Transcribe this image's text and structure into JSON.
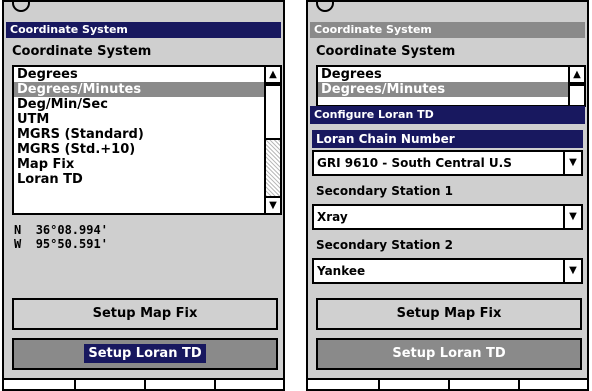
{
  "left": {
    "title": "Coordinate System",
    "section_label": "Coordinate System",
    "items": [
      "Degrees",
      "Degrees/Minutes",
      "Deg/Min/Sec",
      "UTM",
      "MGRS (Standard)",
      "MGRS (Std.+10)",
      "Map Fix",
      "Loran TD"
    ],
    "selected_index": 1,
    "coords": {
      "lat_label": "N",
      "lat_value": "36°08.994'",
      "lon_label": "W",
      "lon_value": "95°50.591'"
    },
    "button_map_fix": "Setup Map Fix",
    "button_loran": "Setup Loran TD"
  },
  "right": {
    "title": "Coordinate System",
    "section_label": "Coordinate System",
    "items": [
      "Degrees",
      "Degrees/Minutes"
    ],
    "dialog": {
      "title": "Configure Loran TD",
      "chain_label": "Loran Chain Number",
      "chain_value": "GRI 9610 - South Central U.S",
      "sec1_label": "Secondary Station 1",
      "sec1_value": "Xray",
      "sec2_label": "Secondary Station 2",
      "sec2_value": "Yankee"
    },
    "button_map_fix": "Setup Map Fix",
    "button_loran": "Setup Loran TD"
  },
  "icons": {
    "scroll_up": "▲",
    "scroll_down": "▼",
    "dropdown": "▼"
  }
}
